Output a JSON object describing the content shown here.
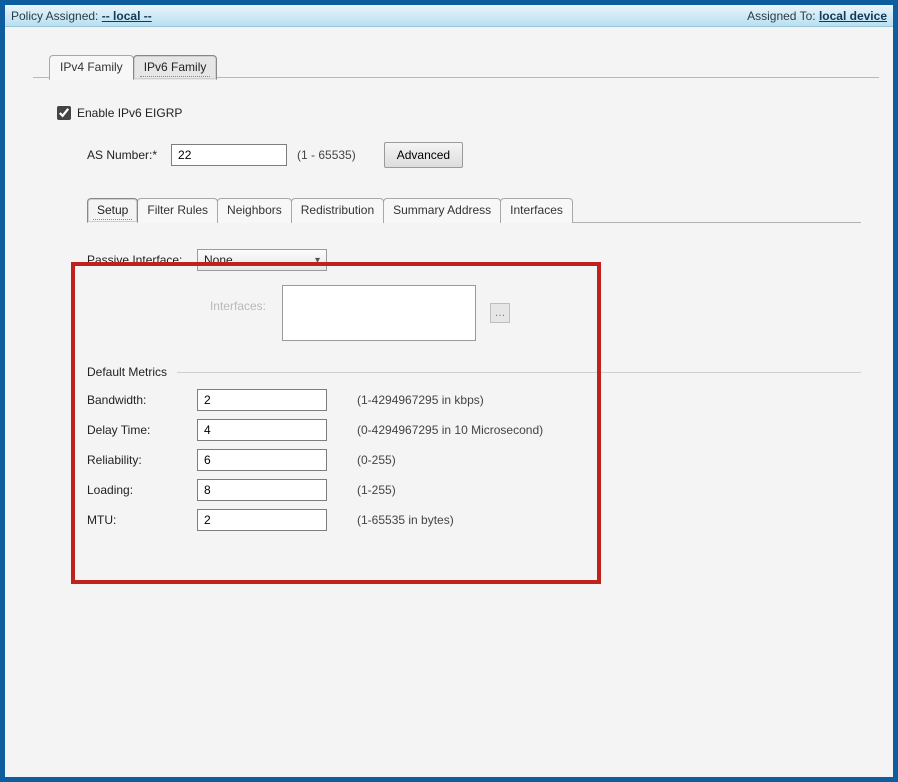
{
  "header": {
    "policy_label": "Policy Assigned:",
    "policy_value": "-- local --",
    "assigned_label": "Assigned To:",
    "assigned_value": "local device"
  },
  "family_tabs": [
    {
      "label": "IPv4 Family",
      "active": false
    },
    {
      "label": "IPv6 Family",
      "active": true
    }
  ],
  "enable": {
    "label": "Enable IPv6 EIGRP",
    "checked": true
  },
  "as": {
    "label": "AS Number:*",
    "value": "22",
    "range": "(1 - 65535)",
    "advanced_label": "Advanced"
  },
  "sub_tabs": [
    {
      "label": "Setup",
      "active": true
    },
    {
      "label": "Filter Rules",
      "active": false
    },
    {
      "label": "Neighbors",
      "active": false
    },
    {
      "label": "Redistribution",
      "active": false
    },
    {
      "label": "Summary Address",
      "active": false
    },
    {
      "label": "Interfaces",
      "active": false
    }
  ],
  "setup": {
    "passive_label": "Passive Interface:",
    "passive_value": "None",
    "interfaces_label": "Interfaces:",
    "interfaces_value": "",
    "default_metrics_title": "Default Metrics",
    "metrics": {
      "bandwidth_label": "Bandwidth:",
      "bandwidth_value": "2",
      "bandwidth_hint": "(1-4294967295 in kbps)",
      "delay_label": "Delay Time:",
      "delay_value": "4",
      "delay_hint": "(0-4294967295 in 10 Microsecond)",
      "reliability_label": "Reliability:",
      "reliability_value": "6",
      "reliability_hint": "(0-255)",
      "loading_label": "Loading:",
      "loading_value": "8",
      "loading_hint": "(1-255)",
      "mtu_label": "MTU:",
      "mtu_value": "2",
      "mtu_hint": "(1-65535 in bytes)"
    }
  }
}
